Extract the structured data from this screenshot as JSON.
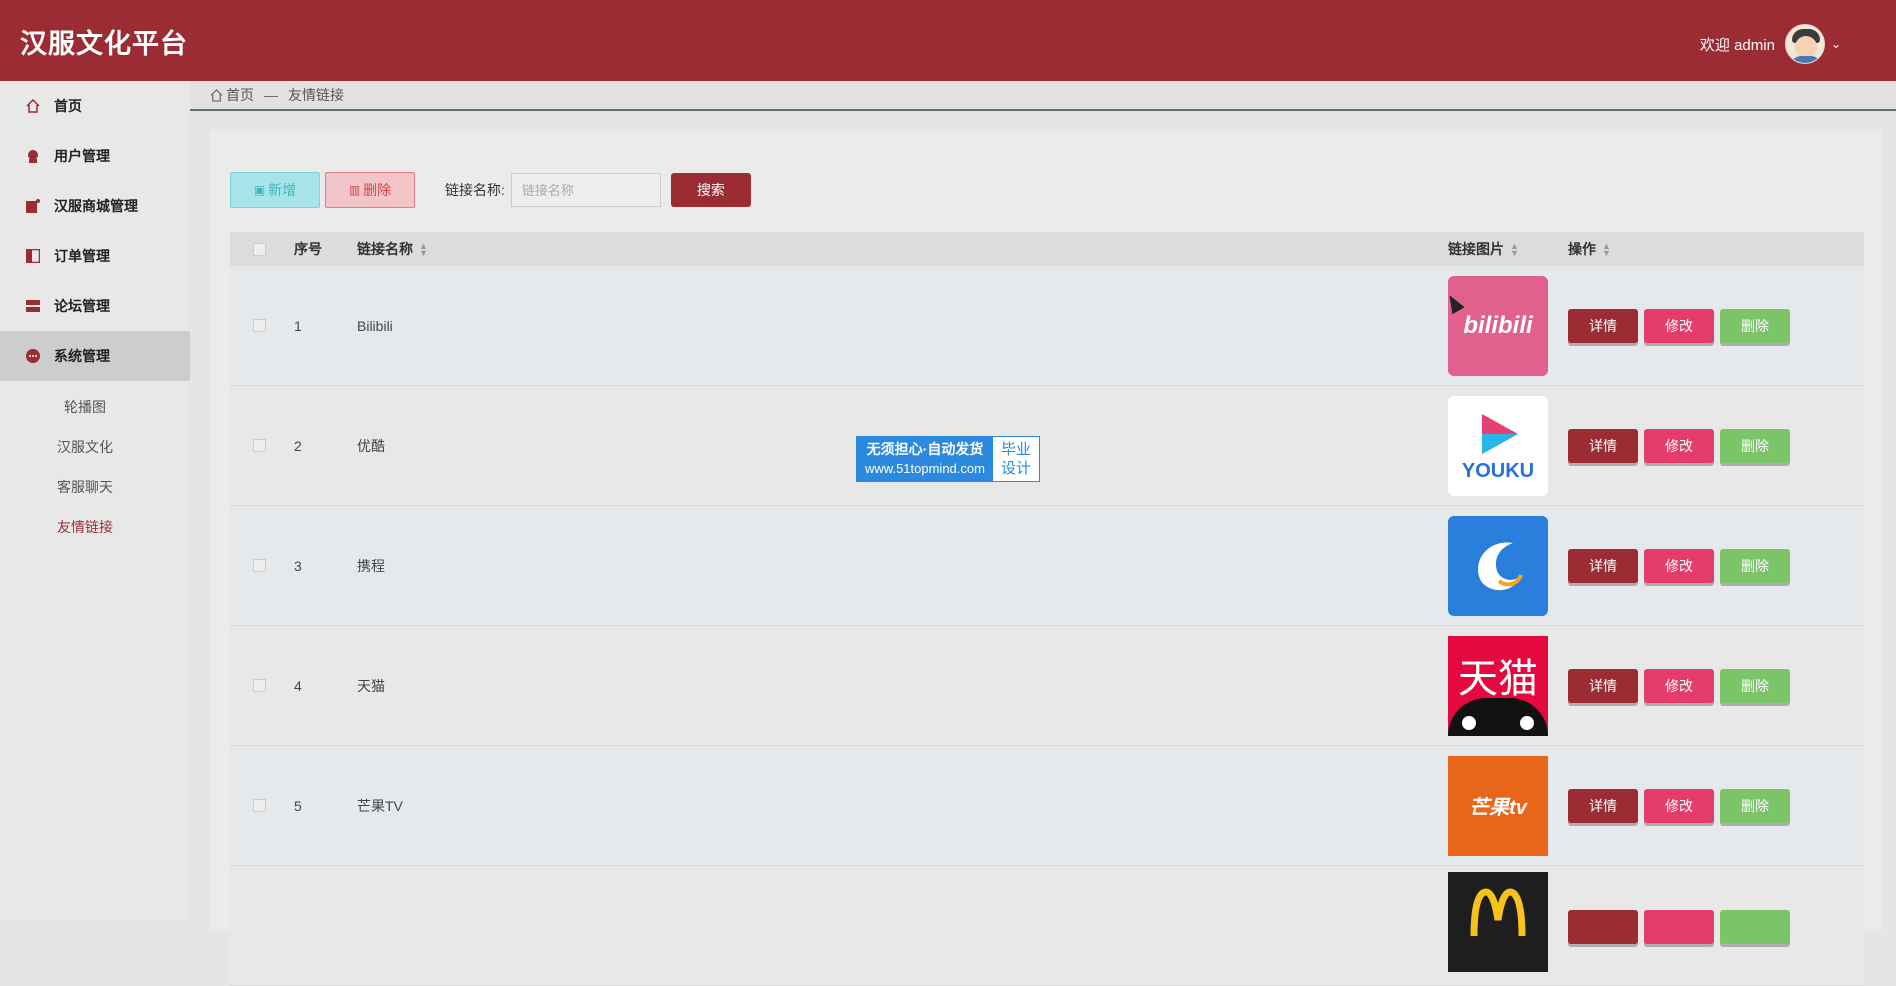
{
  "header": {
    "brand": "汉服文化平台",
    "welcome": "欢迎 admin"
  },
  "sidebar": {
    "items": [
      {
        "label": "首页",
        "icon": "home-icon"
      },
      {
        "label": "用户管理",
        "icon": "user-icon"
      },
      {
        "label": "汉服商城管理",
        "icon": "shop-icon"
      },
      {
        "label": "订单管理",
        "icon": "order-icon"
      },
      {
        "label": "论坛管理",
        "icon": "forum-icon"
      },
      {
        "label": "系统管理",
        "icon": "system-icon"
      }
    ],
    "sub_items": [
      "轮播图",
      "汉服文化",
      "客服聊天",
      "友情链接"
    ]
  },
  "breadcrumb": {
    "home": "首页",
    "sep": "—",
    "current": "友情链接"
  },
  "toolbar": {
    "add_label": "新增",
    "delete_label": "删除",
    "search_label": "链接名称:",
    "search_placeholder": "链接名称",
    "search_button": "搜索"
  },
  "table": {
    "headers": {
      "index": "序号",
      "name": "链接名称",
      "image": "链接图片",
      "ops": "操作"
    },
    "rows": [
      {
        "index": "1",
        "name": "Bilibili",
        "logo_text": "bilibili"
      },
      {
        "index": "2",
        "name": "优酷",
        "logo_text": "YOUKU"
      },
      {
        "index": "3",
        "name": "携程",
        "logo_text": ""
      },
      {
        "index": "4",
        "name": "天猫",
        "logo_text": "天猫"
      },
      {
        "index": "5",
        "name": "芒果TV",
        "logo_text": "芒果tv"
      }
    ],
    "op_labels": {
      "detail": "详情",
      "edit": "修改",
      "remove": "删除"
    }
  },
  "watermark": {
    "line1": "无须担心·自动发货",
    "line2": "www.51topmind.com",
    "right1": "毕业",
    "right2": "设计"
  },
  "colors": {
    "primary": "#9b2c34",
    "edit": "#e43d6b",
    "remove": "#7bc468",
    "add": "#a6e4ea"
  }
}
